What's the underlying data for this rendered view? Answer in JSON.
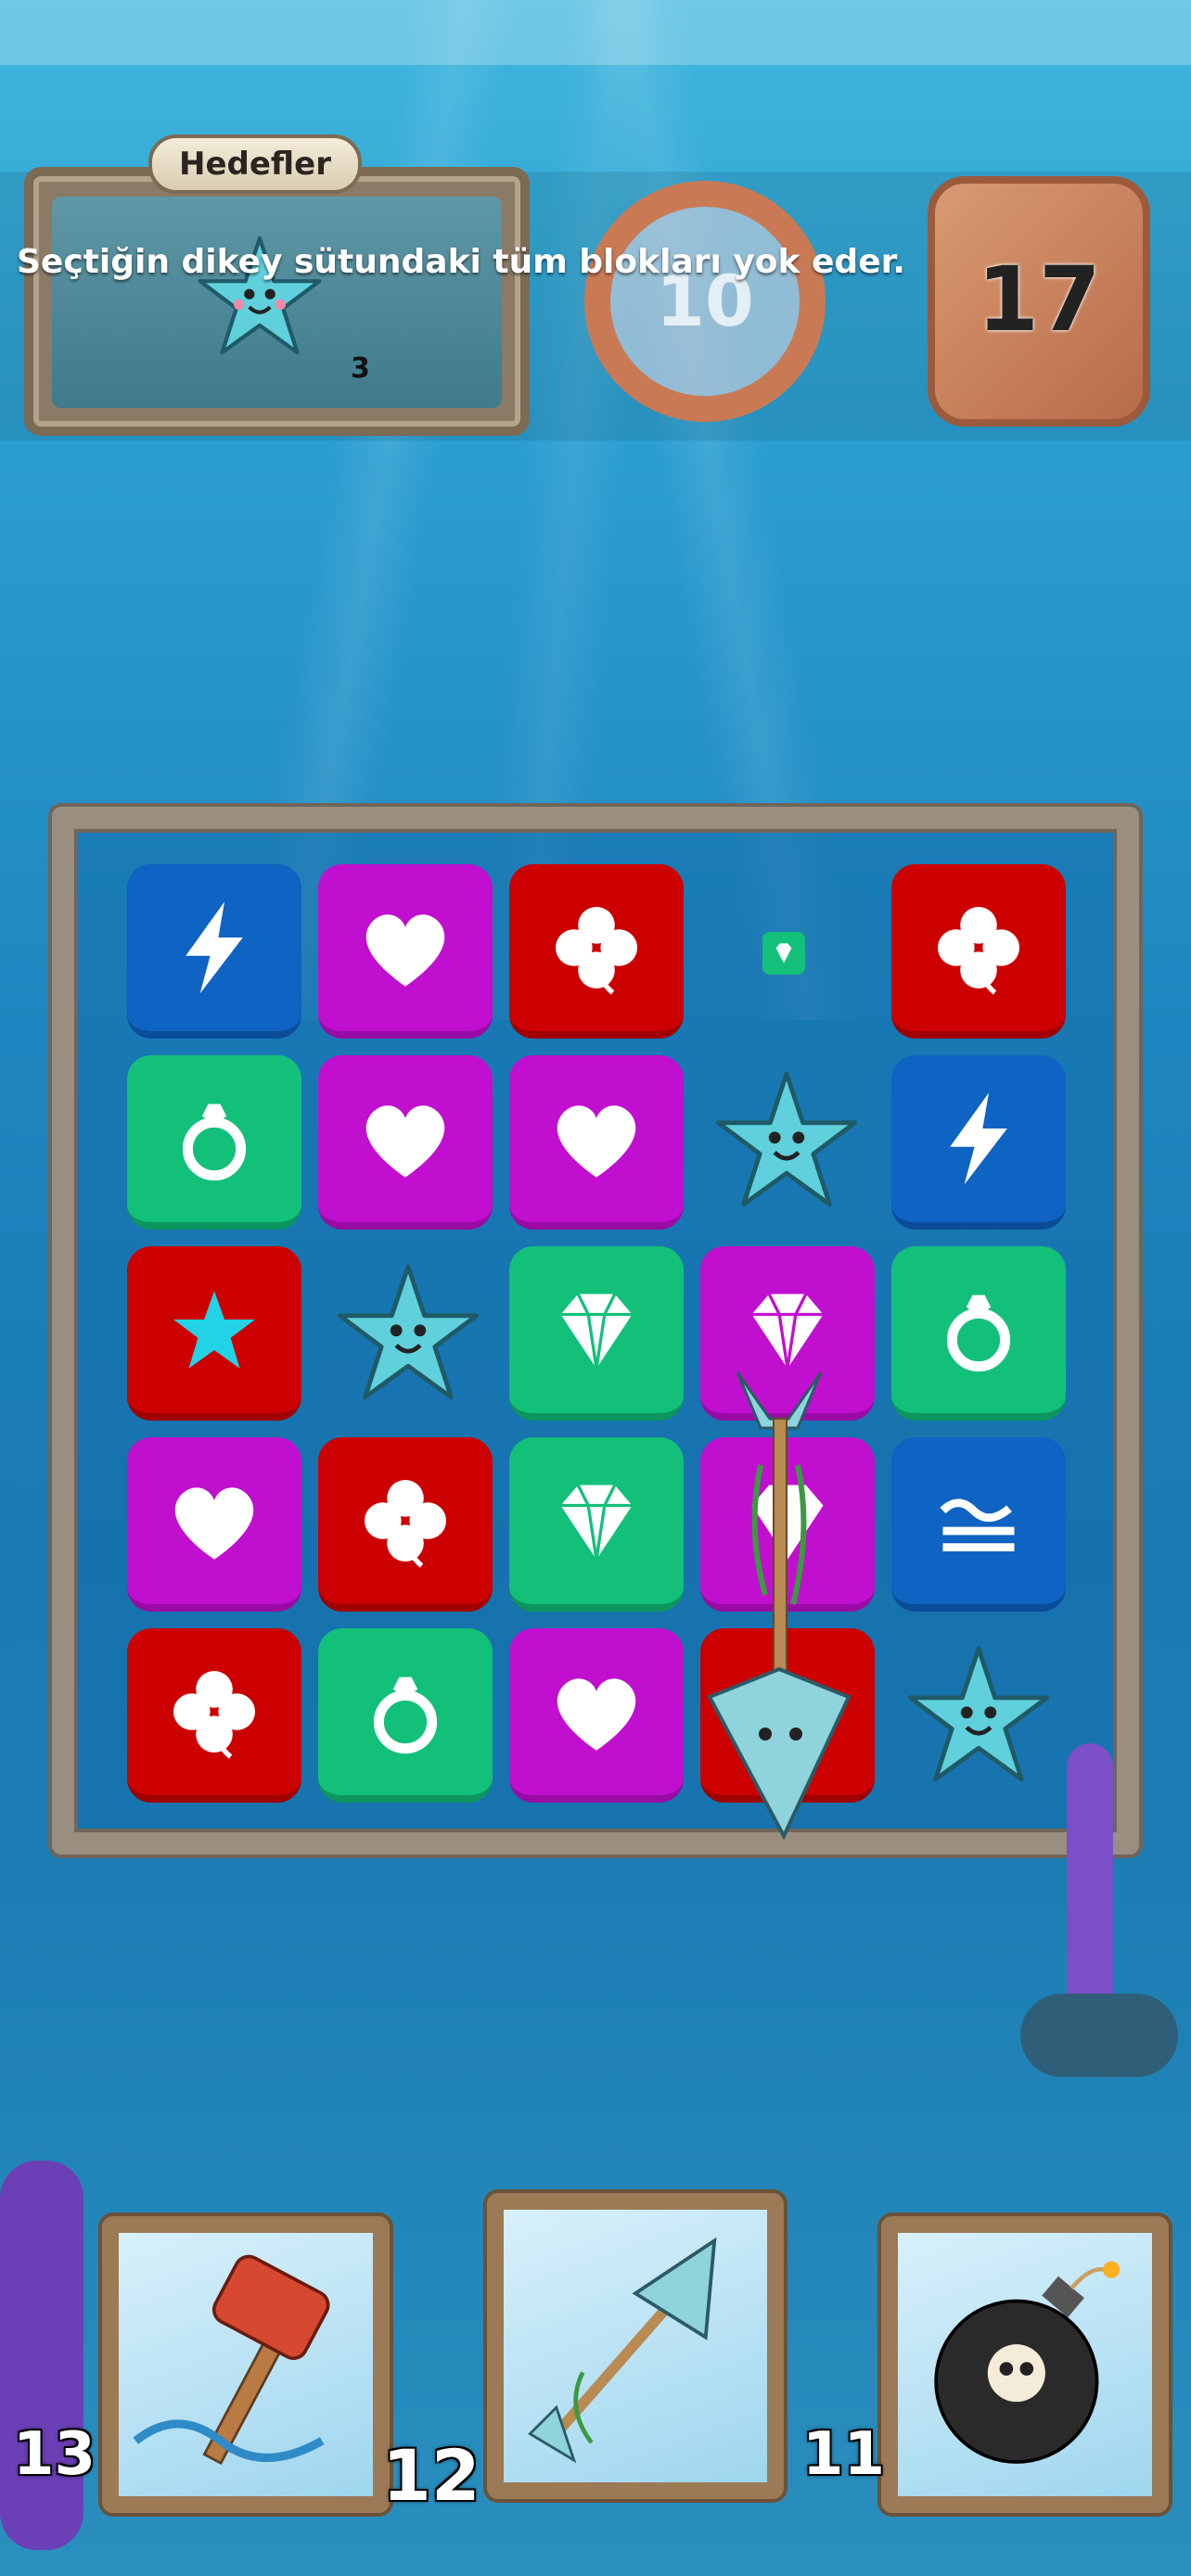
{
  "hud": {
    "goals_title": "Hedefler",
    "goal": {
      "icon": "starfish-icon",
      "count": "3"
    },
    "moves": "10",
    "score": "17"
  },
  "tooltip": "Seçtiğin dikey sütundaki tüm blokları yok eder.",
  "board": {
    "rows": [
      [
        "blue:lightning",
        "purple:heart",
        "red:clover",
        "empty:mini-gem",
        "red:clover"
      ],
      [
        "green:ring",
        "purple:heart",
        "purple:heart",
        "starfish",
        "blue:lightning"
      ],
      [
        "red:star",
        "starfish",
        "green:diamond",
        "purple:diamond",
        "green:ring"
      ],
      [
        "purple:heart",
        "red:clover",
        "green:diamond",
        "purple:diamond",
        "blue:wave"
      ],
      [
        "red:clover",
        "green:ring",
        "purple:heart",
        "red:blank",
        "starfish"
      ]
    ],
    "active_tool": "trident-icon"
  },
  "powerups": [
    {
      "icon": "hammer-icon",
      "count": "13"
    },
    {
      "icon": "trident-icon",
      "count": "12"
    },
    {
      "icon": "bomb-icon",
      "count": "11"
    }
  ],
  "colors": {
    "blue": "#0f63c2",
    "purple": "#c10fcf",
    "red": "#cc0000",
    "green": "#13c07a"
  }
}
